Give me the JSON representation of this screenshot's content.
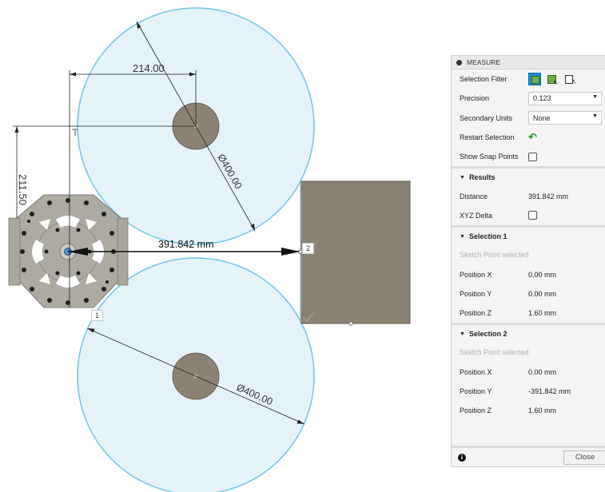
{
  "canvas": {
    "dim_horizontal": "214.00",
    "dim_vertical": "211.50",
    "diameter_top": "Ø400.00",
    "diameter_bottom": "Ø400.00",
    "distance_label": "391.842 mm",
    "point_tag_1": "1",
    "point_tag_2": "2"
  },
  "panel": {
    "title": "MEASURE",
    "selection_filter_label": "Selection Filter",
    "precision_label": "Precision",
    "precision_value": "0.123",
    "secondary_units_label": "Secondary Units",
    "secondary_units_value": "None",
    "restart_selection_label": "Restart Selection",
    "show_snap_points_label": "Show Snap Points",
    "results_title": "Results",
    "distance_label": "Distance",
    "distance_value": "391.842 mm",
    "xyz_delta_label": "XYZ Delta",
    "selection1_title": "Selection 1",
    "selection1_hint": "Sketch Point selected",
    "s1_px_label": "Position X",
    "s1_px_value": "0.00 mm",
    "s1_py_label": "Position Y",
    "s1_py_value": "0.00 mm",
    "s1_pz_label": "Position Z",
    "s1_pz_value": "1.60 mm",
    "selection2_title": "Selection 2",
    "selection2_hint": "Sketch Point selected",
    "s2_px_label": "Position X",
    "s2_px_value": "0.00 mm",
    "s2_py_label": "Position Y",
    "s2_py_value": "-391.842 mm",
    "s2_pz_label": "Position Z",
    "s2_pz_value": "1.60 mm",
    "close_label": "Close"
  },
  "colors": {
    "circle_fill": "#e6f2fa",
    "circle_stroke": "#6ec4e8",
    "hub_fill": "#8b8274",
    "plate_fill": "#8a8272",
    "selected_icon": "#1a8fd6"
  }
}
